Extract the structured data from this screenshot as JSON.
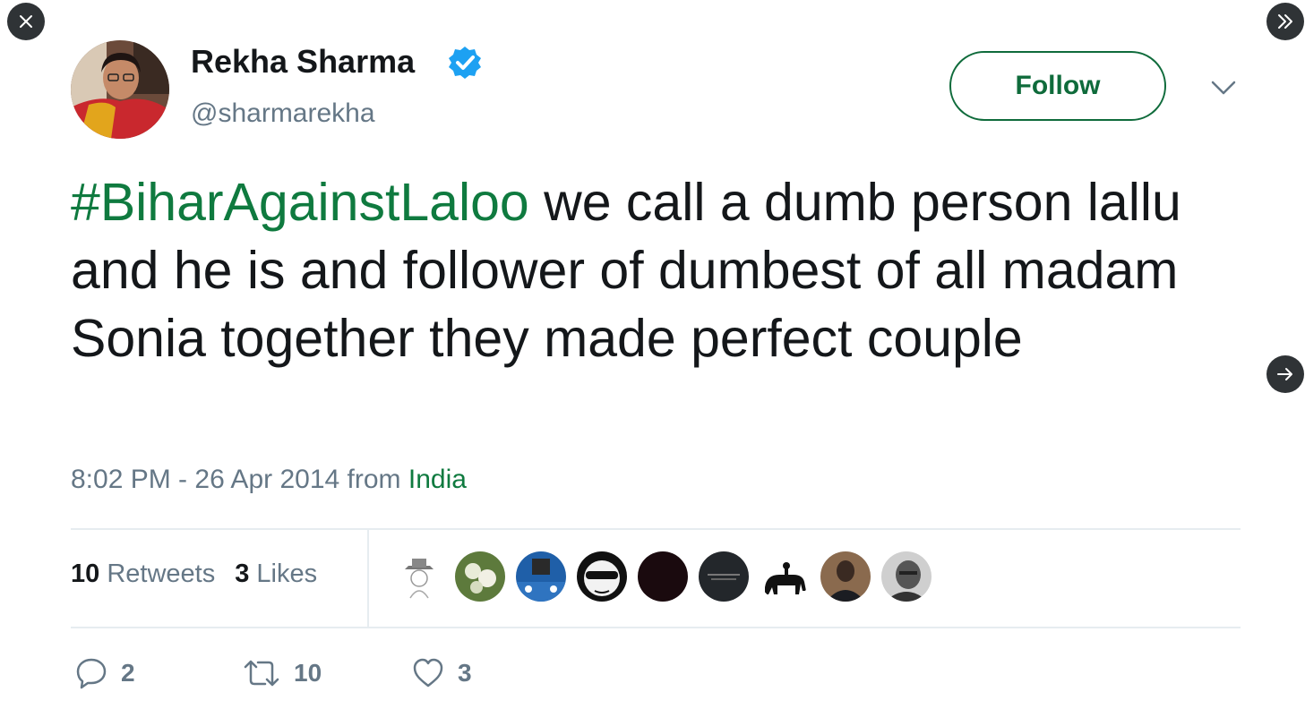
{
  "user": {
    "display_name": "Rekha Sharma",
    "handle": "@sharmarekha",
    "verified": true
  },
  "follow_button": {
    "label": "Follow"
  },
  "tweet": {
    "hashtag": "#BiharAgainstLaloo",
    "text": " we call a dumb person lallu and he is and follower of dumbest of all madam Sonia together they made perfect couple",
    "timestamp_prefix": "8:02 PM - 26 Apr 2014 from ",
    "location": "India"
  },
  "stats": {
    "retweets_count": "10",
    "retweets_label": "Retweets",
    "likes_count": "3",
    "likes_label": "Likes"
  },
  "actions": {
    "reply_count": "2",
    "retweet_count": "10",
    "like_count": "3"
  },
  "colors": {
    "accent": "#0f7a3f",
    "verified": "#1da1f2",
    "muted": "#657786",
    "overlay_button": "#2f3336"
  },
  "icons": {
    "close": "close-icon",
    "expand": "double-chevron-right-icon",
    "next": "arrow-right-icon",
    "more": "chevron-down-icon",
    "reply": "reply-icon",
    "retweet": "retweet-icon",
    "like": "heart-icon"
  }
}
